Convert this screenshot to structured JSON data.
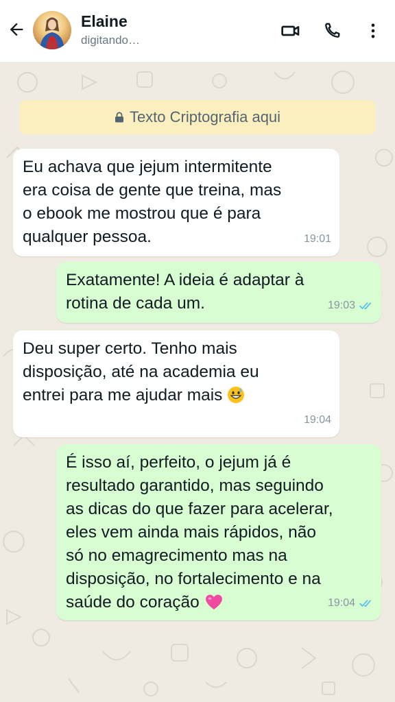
{
  "header": {
    "contact_name": "Elaine",
    "contact_status": "digitando…",
    "icons": [
      "back-arrow-icon",
      "video-call-icon",
      "phone-icon",
      "more-vert-icon"
    ]
  },
  "encryption_banner": {
    "text": "Texto Criptografia aqui"
  },
  "messages": [
    {
      "direction": "incoming",
      "lines": [
        "Eu achava que jejum intermitente",
        "era coisa de gente que treina, mas",
        "o ebook me mostrou que é para",
        "qualquer pessoa."
      ],
      "time": "19:01"
    },
    {
      "direction": "outgoing",
      "lines": [
        "Exatamente! A ideia é adaptar à",
        "rotina de cada um."
      ],
      "time": "19:03",
      "status": "read"
    },
    {
      "direction": "incoming",
      "lines": [
        "Deu super certo. Tenho mais",
        "disposição, até na academia eu",
        "entrei para me ajudar mais"
      ],
      "time": "19:04"
    },
    {
      "direction": "outgoing",
      "lines": [
        "É isso aí, perfeito, o jejum já é",
        "resultado garantido, mas seguindo",
        "as dicas do que fazer para acelerar,",
        "eles vem ainda mais rápidos, não",
        "só no emagrecimento mas na",
        "disposição, no fortalecimento e na",
        "saúde do coração"
      ],
      "time": "19:04",
      "status": "read"
    }
  ],
  "colors": {
    "header_bg": "#ffffff",
    "chat_bg": "#efeae2",
    "incoming_bubble": "#ffffff",
    "outgoing_bubble": "#d9fdd3",
    "banner_bg": "#fcefbf",
    "read_ticks": "#53bdeb"
  }
}
